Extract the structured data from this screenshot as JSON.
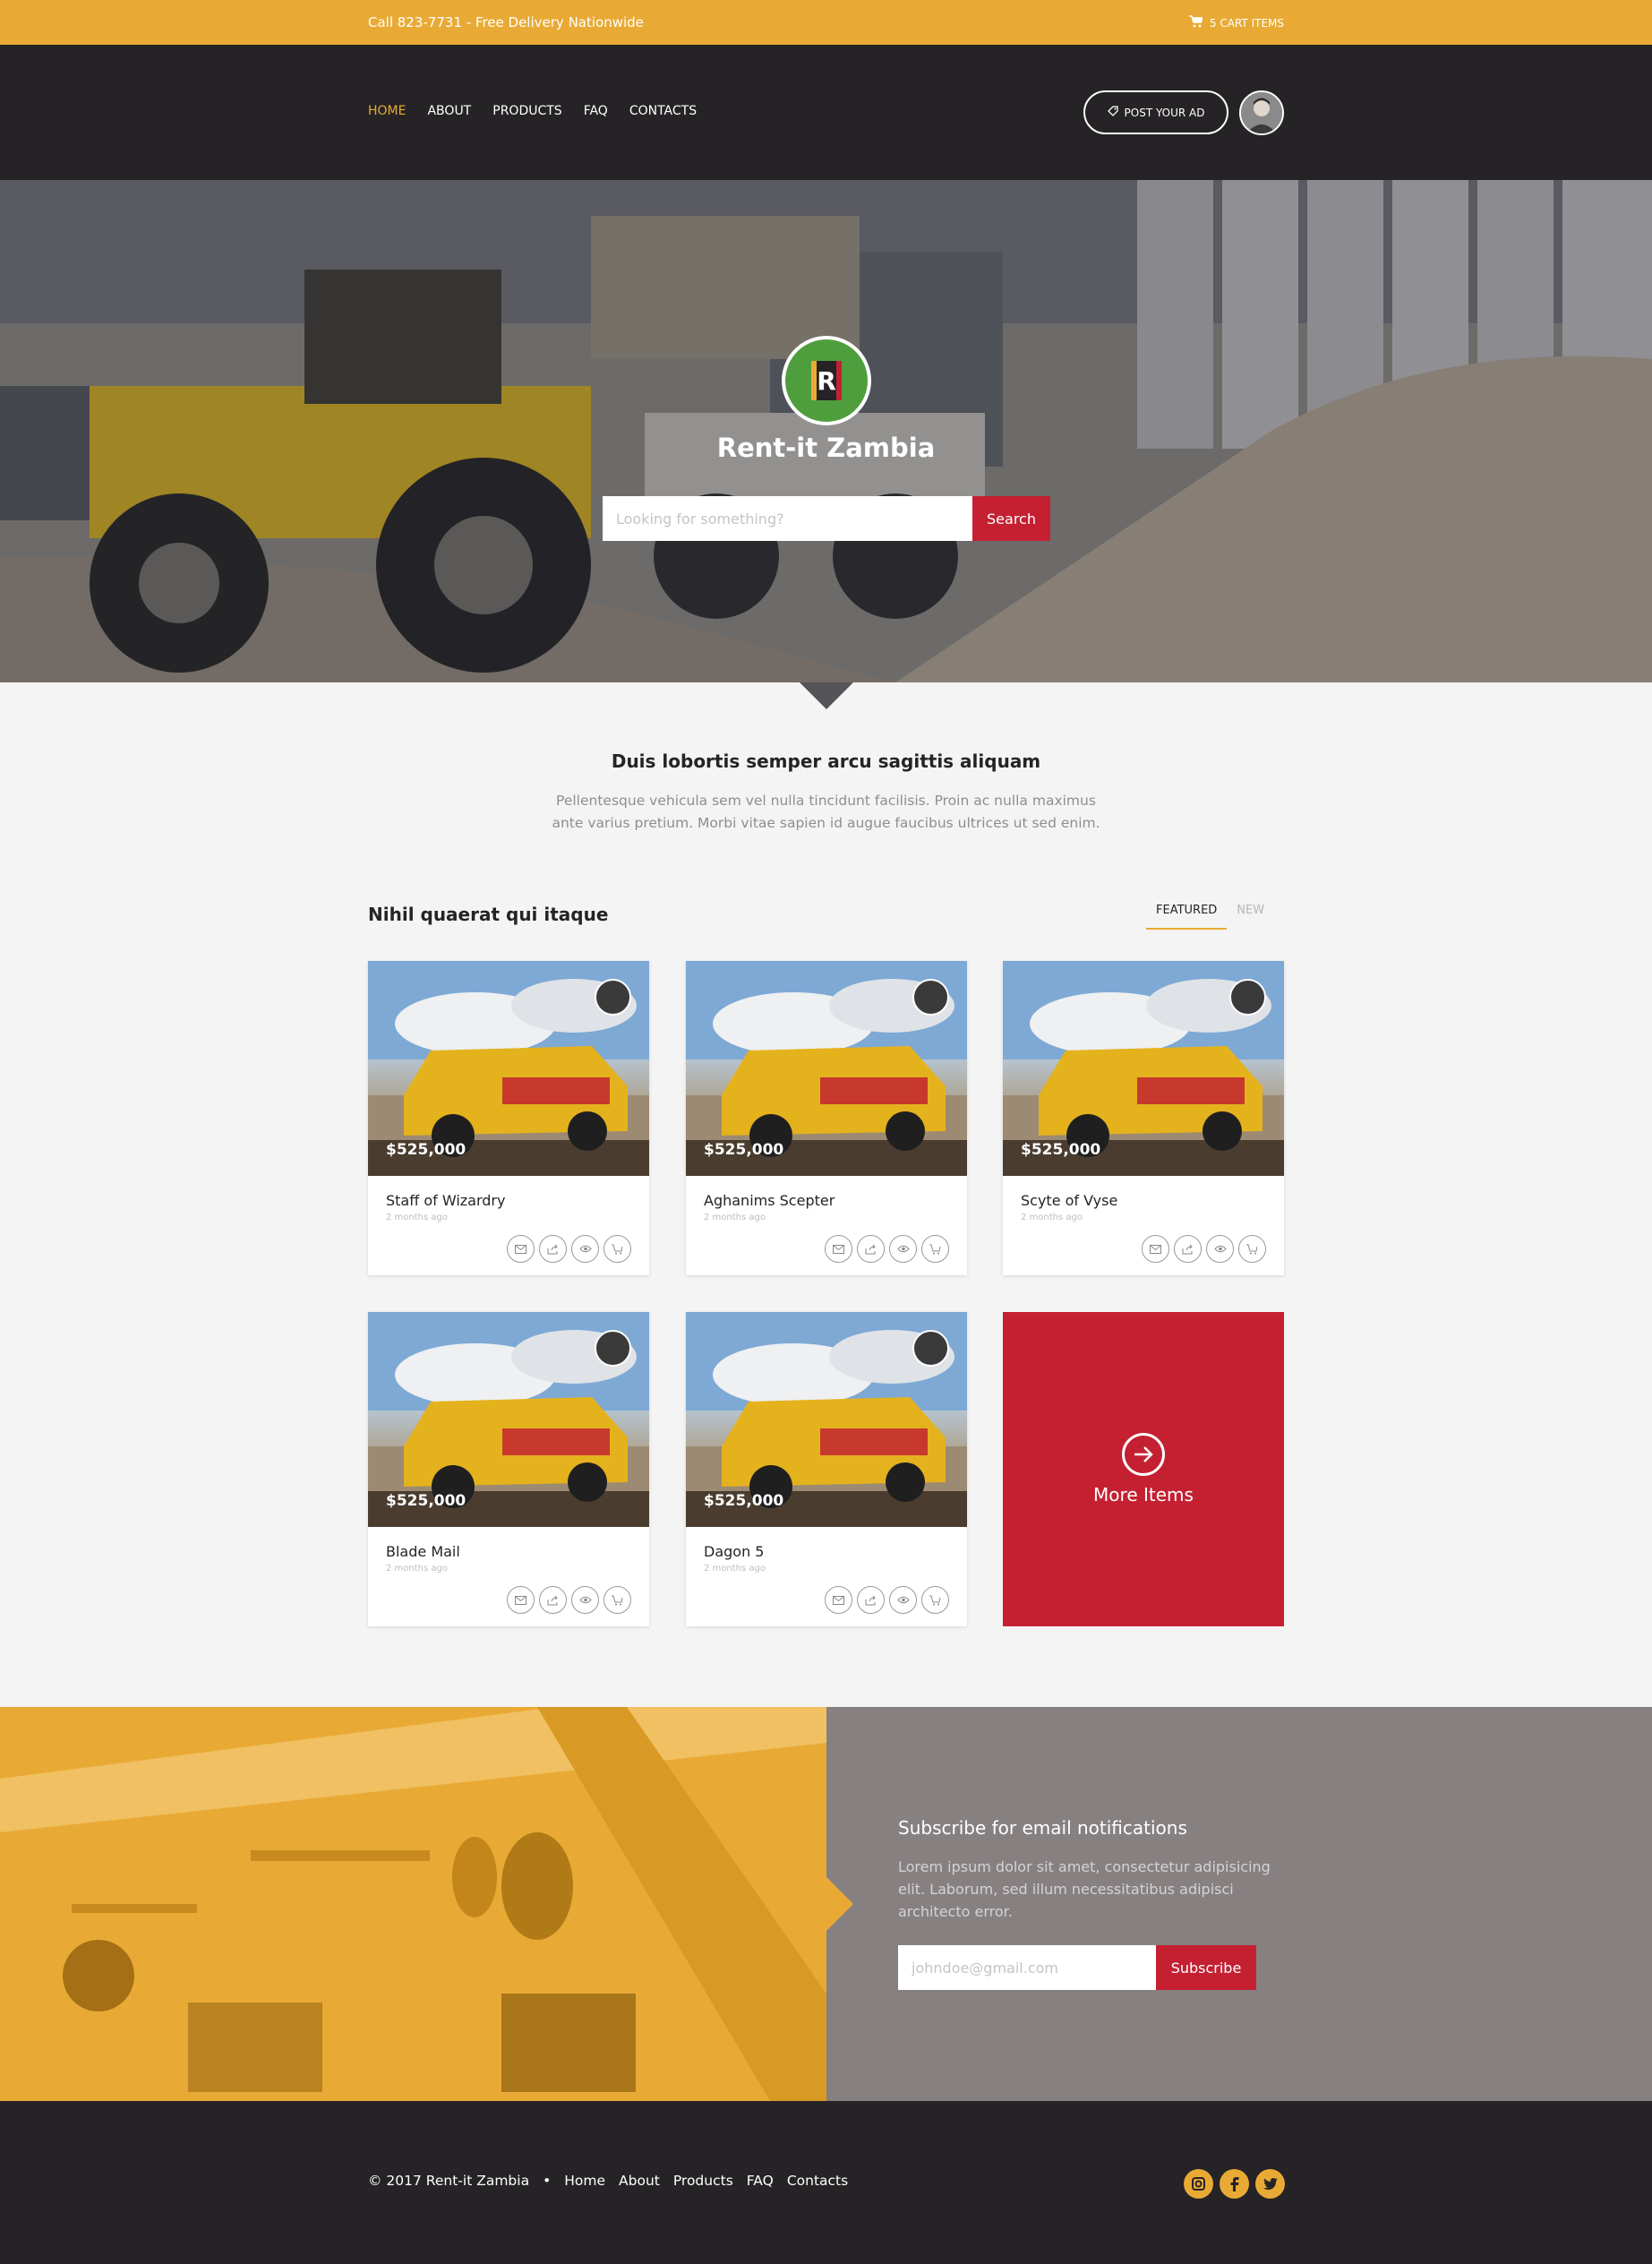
{
  "topbar": {
    "contact": "Call 823-7731 - Free Delivery Nationwide",
    "cart": "5 CART ITEMS",
    "color": "#e9aa35"
  },
  "nav": {
    "items": [
      {
        "label": "HOME",
        "active": true
      },
      {
        "label": "ABOUT"
      },
      {
        "label": "PRODUCTS"
      },
      {
        "label": "FAQ"
      },
      {
        "label": "CONTACTS"
      }
    ],
    "post_ad": "POST YOUR AD"
  },
  "hero": {
    "title": "Rent-it Zambia",
    "logo_letter": "R",
    "search_placeholder": "Looking for something?",
    "search_button": "Search"
  },
  "intro": {
    "heading": "Duis lobortis semper arcu sagittis aliquam",
    "text": "Pellentesque vehicula sem vel nulla tincidunt facilisis. Proin ac nulla maximus ante varius pretium. Morbi vitae sapien id augue faucibus ultrices ut sed enim."
  },
  "listing": {
    "title": "Nihil quaerat qui itaque",
    "tabs": [
      "FEATURED",
      "NEW"
    ],
    "items": [
      {
        "name": "Staff of Wizardry",
        "price": "$525,000",
        "date": "2 months ago"
      },
      {
        "name": "Aghanims Scepter",
        "price": "$525,000",
        "date": "2 months ago"
      },
      {
        "name": "Scyte of Vyse",
        "price": "$525,000",
        "date": "2 months ago"
      },
      {
        "name": "Blade Mail",
        "price": "$525,000",
        "date": "2 months ago"
      },
      {
        "name": "Dagon 5",
        "price": "$525,000",
        "date": "2 months ago"
      }
    ],
    "more": "More Items"
  },
  "subscribe": {
    "title": "Subscribe for email notifications",
    "text": "Lorem ipsum dolor sit amet, consectetur adipisicing elit. Laborum, sed illum necessitatibus adipisci architecto error.",
    "placeholder": "johndoe@gmail.com",
    "button": "Subscribe"
  },
  "footer": {
    "copyright": "© 2017 Rent-it Zambia",
    "separator": "•",
    "links": [
      "Home",
      "About",
      "Products",
      "FAQ",
      "Contacts"
    ],
    "social": [
      "instagram-icon",
      "facebook-icon",
      "twitter-icon"
    ]
  },
  "colors": {
    "accent": "#e9aa35",
    "primary": "#c42032",
    "dark": "#262326"
  }
}
